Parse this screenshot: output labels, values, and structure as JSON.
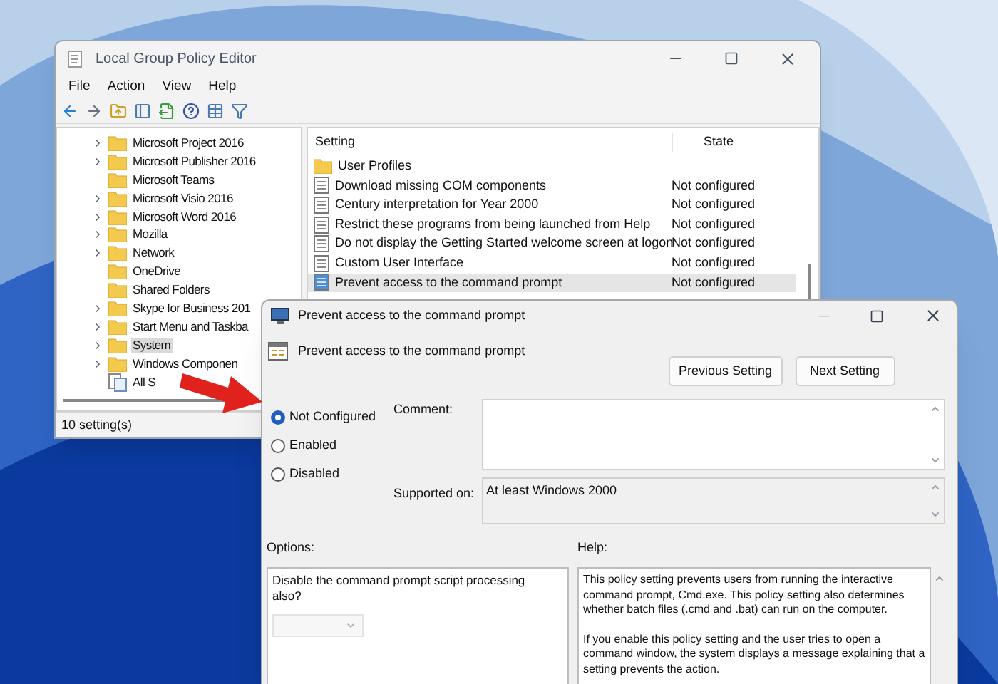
{
  "main_window": {
    "title": "Local Group Policy Editor",
    "menu": [
      "File",
      "Action",
      "View",
      "Help"
    ],
    "tree": [
      {
        "label": "Microsoft Project 2016",
        "has_children": true,
        "kind": "folder",
        "selected": false
      },
      {
        "label": "Microsoft Publisher 2016",
        "has_children": true,
        "kind": "folder",
        "selected": false
      },
      {
        "label": "Microsoft Teams",
        "has_children": false,
        "kind": "folder",
        "selected": false
      },
      {
        "label": "Microsoft Visio 2016",
        "has_children": true,
        "kind": "folder",
        "selected": false
      },
      {
        "label": "Microsoft Word 2016",
        "has_children": true,
        "kind": "folder",
        "selected": false
      },
      {
        "label": "Mozilla",
        "has_children": true,
        "kind": "folder",
        "selected": false
      },
      {
        "label": "Network",
        "has_children": true,
        "kind": "folder",
        "selected": false
      },
      {
        "label": "OneDrive",
        "has_children": false,
        "kind": "folder",
        "selected": false
      },
      {
        "label": "Shared Folders",
        "has_children": false,
        "kind": "folder",
        "selected": false
      },
      {
        "label": "Skype for Business 201",
        "has_children": true,
        "kind": "folder",
        "selected": false
      },
      {
        "label": "Start Menu and Taskba",
        "has_children": true,
        "kind": "folder",
        "selected": false
      },
      {
        "label": "System",
        "has_children": true,
        "kind": "folder",
        "selected": true
      },
      {
        "label": "Windows Componen",
        "has_children": true,
        "kind": "folder",
        "selected": false
      },
      {
        "label": "All S",
        "has_children": false,
        "kind": "all-settings",
        "selected": false
      }
    ],
    "table": {
      "columns": [
        "Setting",
        "State"
      ],
      "rows": [
        {
          "setting": "User Profiles",
          "state": "",
          "kind": "folder",
          "selected": false
        },
        {
          "setting": "Download missing COM components",
          "state": "Not configured",
          "kind": "policy",
          "selected": false
        },
        {
          "setting": "Century interpretation for Year 2000",
          "state": "Not configured",
          "kind": "policy",
          "selected": false
        },
        {
          "setting": "Restrict these programs from being launched from Help",
          "state": "Not configured",
          "kind": "policy",
          "selected": false
        },
        {
          "setting": "Do not display the Getting Started welcome screen at logon",
          "state": "Not configured",
          "kind": "policy",
          "selected": false
        },
        {
          "setting": "Custom User Interface",
          "state": "Not configured",
          "kind": "policy",
          "selected": false
        },
        {
          "setting": "Prevent access to the command prompt",
          "state": "Not configured",
          "kind": "policy",
          "selected": true
        }
      ]
    },
    "status_bar": "10 setting(s)"
  },
  "dialog": {
    "title": "Prevent access to the command prompt",
    "heading": "Prevent access to the command prompt",
    "buttons": [
      "Previous Setting",
      "Next Setting"
    ],
    "radios": [
      {
        "label": "Not Configured",
        "selected": true
      },
      {
        "label": "Enabled",
        "selected": false
      },
      {
        "label": "Disabled",
        "selected": false
      }
    ],
    "comment_label": "Comment:",
    "supported_label": "Supported on:",
    "supported_value": "At least Windows 2000",
    "options_label": "Options:",
    "help_label": "Help:",
    "option_text": "Disable the command prompt script processing also?",
    "help_paragraphs": [
      "This policy setting prevents users from running the interactive command prompt, Cmd.exe.  This policy setting also determines whether batch files (.cmd and .bat) can run on the computer.",
      "If you enable this policy setting and the user tries to open a command window, the system displays a message explaining that a setting prevents the action."
    ]
  }
}
